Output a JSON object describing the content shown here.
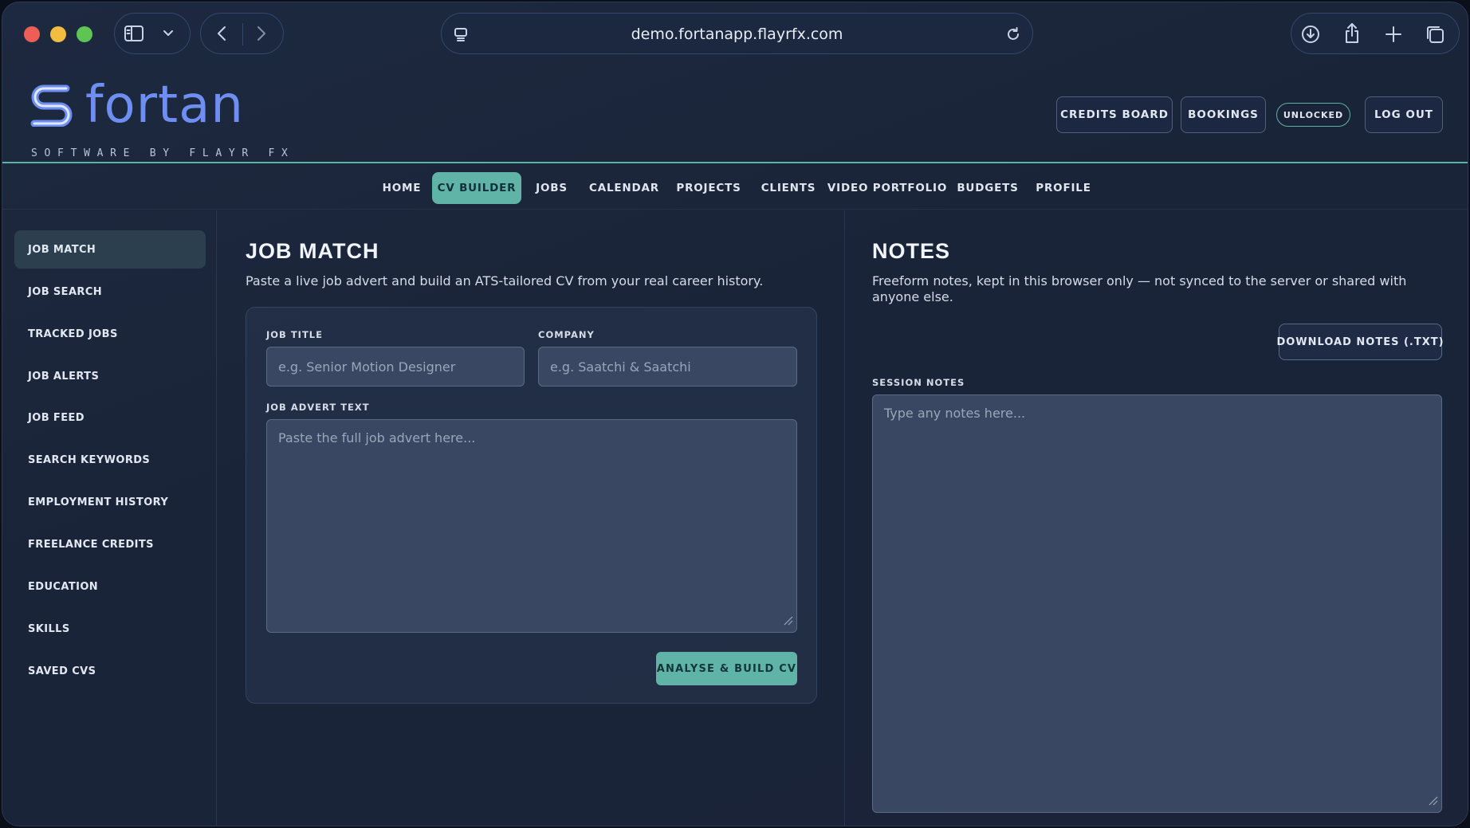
{
  "browser": {
    "url": "demo.fortanapp.flayrfx.com"
  },
  "brand": {
    "name": "fortan",
    "tagline": "SOFTWARE BY FLAYR FX",
    "logo_color": "#6e8ef2"
  },
  "header": {
    "credits_board": "CREDITS BOARD",
    "bookings": "BOOKINGS",
    "unlocked_badge": "UNLOCKED",
    "log_out": "LOG OUT"
  },
  "nav": {
    "tabs": [
      {
        "label": "HOME"
      },
      {
        "label": "CV BUILDER"
      },
      {
        "label": "JOBS"
      },
      {
        "label": "CALENDAR"
      },
      {
        "label": "PROJECTS"
      },
      {
        "label": "CLIENTS"
      },
      {
        "label": "VIDEO PORTFOLIO"
      },
      {
        "label": "BUDGETS"
      },
      {
        "label": "PROFILE"
      }
    ],
    "active": "CV BUILDER"
  },
  "sidebar": {
    "items": [
      {
        "label": "JOB MATCH"
      },
      {
        "label": "JOB SEARCH"
      },
      {
        "label": "TRACKED JOBS"
      },
      {
        "label": "JOB ALERTS"
      },
      {
        "label": "JOB FEED"
      },
      {
        "label": "SEARCH KEYWORDS"
      },
      {
        "label": "EMPLOYMENT HISTORY"
      },
      {
        "label": "FREELANCE CREDITS"
      },
      {
        "label": "EDUCATION"
      },
      {
        "label": "SKILLS"
      },
      {
        "label": "SAVED CVS"
      }
    ],
    "active": "JOB MATCH"
  },
  "job_match": {
    "title": "JOB MATCH",
    "description": "Paste a live job advert and build an ATS-tailored CV from your real career history.",
    "job_title_label": "JOB TITLE",
    "job_title_value": "",
    "job_title_placeholder": "e.g. Senior Motion Designer",
    "company_label": "COMPANY",
    "company_value": "",
    "company_placeholder": "e.g. Saatchi & Saatchi",
    "advert_label": "JOB ADVERT TEXT",
    "advert_value": "",
    "advert_placeholder": "Paste the full job advert here...",
    "submit_label": "ANALYSE & BUILD CV"
  },
  "notes": {
    "title": "NOTES",
    "description": "Freeform notes, kept in this browser only — not synced to the server or shared with anyone else.",
    "download_label": "DOWNLOAD NOTES (.TXT)",
    "session_label": "SESSION NOTES",
    "session_value": "",
    "session_placeholder": "Type any notes here..."
  },
  "colors": {
    "accent": "#5fb4a7",
    "background": "#1a2438",
    "input_bg": "#394762"
  }
}
